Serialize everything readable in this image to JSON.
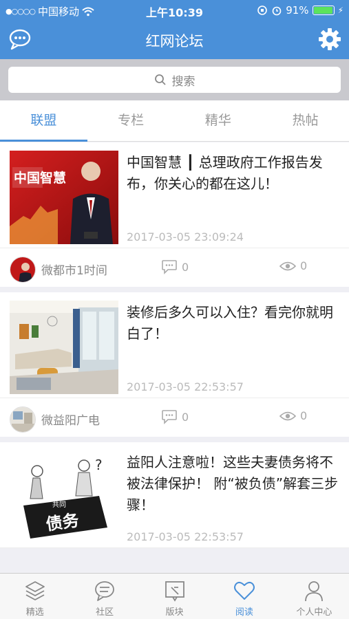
{
  "status": {
    "carrier": "中国移动",
    "time": "上午10:39",
    "battery": "91%",
    "signal_icon": "signal-dots-icon",
    "wifi_icon": "wifi-icon"
  },
  "header": {
    "title": "红网论坛",
    "chat_icon": "chat-bubble-icon",
    "settings_icon": "gear-icon"
  },
  "search": {
    "placeholder": "搜索"
  },
  "tabs": [
    {
      "label": "联盟",
      "active": true
    },
    {
      "label": "专栏",
      "active": false
    },
    {
      "label": "精华",
      "active": false
    },
    {
      "label": "热帖",
      "active": false
    }
  ],
  "posts": [
    {
      "title": "中国智慧 ┃ 总理政府工作报告发布，你关心的都在这儿！",
      "time": "2017-03-05 23:09:24",
      "source": "微都市1时间",
      "comments": "0",
      "views": "0",
      "thumb_text": "中国智慧"
    },
    {
      "title": "装修后多久可以入住？看完你就明白了！",
      "time": "2017-03-05 22:53:57",
      "source": "微益阳广电",
      "comments": "0",
      "views": "0"
    },
    {
      "title": "益阳人注意啦！这些夫妻债务将不被法律保护！ 附“被负债”解套三步骤！",
      "time": "2017-03-05 22:53:57",
      "thumb_text": "债务",
      "thumb_small": "共同"
    }
  ],
  "tabbar": [
    {
      "label": "精选",
      "icon": "layers-icon",
      "active": false
    },
    {
      "label": "社区",
      "icon": "chat-icon",
      "active": false
    },
    {
      "label": "版块",
      "icon": "board-icon",
      "active": false
    },
    {
      "label": "阅读",
      "icon": "heart-icon",
      "active": true
    },
    {
      "label": "个人中心",
      "icon": "person-icon",
      "active": false
    }
  ],
  "colors": {
    "brand": "#4a90d9",
    "battery": "#5ce35c"
  }
}
